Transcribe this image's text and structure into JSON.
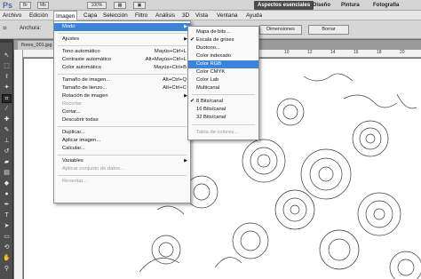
{
  "app": {
    "logo": "Ps",
    "mini_buttons": [
      "Br",
      "Mb",
      "100%"
    ],
    "workspaces": [
      "Aspectos esenciales",
      "Diseño",
      "Pintura",
      "Fotografía"
    ],
    "active_workspace": "Aspectos esenciales"
  },
  "menubar": [
    "Archivo",
    "Edición",
    "Imagen",
    "Capa",
    "Selección",
    "Filtro",
    "Análisis",
    "3D",
    "Vista",
    "Ventana",
    "Ayuda"
  ],
  "options": {
    "label": "Anchura:",
    "dimensions_button": "Dimensiones",
    "clear_button": "Borrar"
  },
  "document": {
    "tab": "flores_001.jpg"
  },
  "ruler_top": [
    "10",
    "12",
    "14",
    "16",
    "18",
    "20"
  ],
  "imagen_menu": [
    {
      "label": "Modo",
      "submenu": true,
      "highlight": true
    },
    {
      "sep": true
    },
    {
      "label": "Ajustes",
      "submenu": true
    },
    {
      "sep": true
    },
    {
      "label": "Tono automático",
      "shortcut": "Mayús+Ctrl+L"
    },
    {
      "label": "Contraste automático",
      "shortcut": "Alt+Mayús+Ctrl+L"
    },
    {
      "label": "Color automático",
      "shortcut": "Mayús+Ctrl+B"
    },
    {
      "sep": true
    },
    {
      "label": "Tamaño de imagen...",
      "shortcut": "Alt+Ctrl+Q"
    },
    {
      "label": "Tamaño de lienzo...",
      "shortcut": "Alt+Ctrl+C"
    },
    {
      "label": "Rotación de imagen",
      "submenu": true
    },
    {
      "label": "Recortar",
      "disabled": true
    },
    {
      "label": "Cortar..."
    },
    {
      "label": "Descubrir todas"
    },
    {
      "sep": true
    },
    {
      "label": "Duplicar..."
    },
    {
      "label": "Aplicar imagen..."
    },
    {
      "label": "Calcular..."
    },
    {
      "sep": true
    },
    {
      "label": "Variables",
      "submenu": true
    },
    {
      "label": "Aplicar conjunto de datos...",
      "disabled": true
    },
    {
      "sep": true
    },
    {
      "label": "Reventar...",
      "disabled": true
    }
  ],
  "modo_submenu": [
    {
      "label": "Mapa de bits..."
    },
    {
      "label": "Escala de grises",
      "checked": true
    },
    {
      "label": "Duotono..."
    },
    {
      "label": "Color indexado"
    },
    {
      "label": "Color RGB",
      "highlight": true
    },
    {
      "label": "Color CMYK"
    },
    {
      "label": "Color Lab"
    },
    {
      "label": "Multicanal"
    },
    {
      "sep": true
    },
    {
      "label": "8 Bits/canal",
      "checked": true
    },
    {
      "label": "16 Bits/canal"
    },
    {
      "label": "32 Bits/canal"
    },
    {
      "sep": true
    },
    {
      "label": "Tabla de colores...",
      "disabled": true
    }
  ],
  "colors": {
    "highlight": "#3c84d8",
    "menu_bg": "#f9f9f9",
    "toolbox": "#4e4e4e"
  }
}
